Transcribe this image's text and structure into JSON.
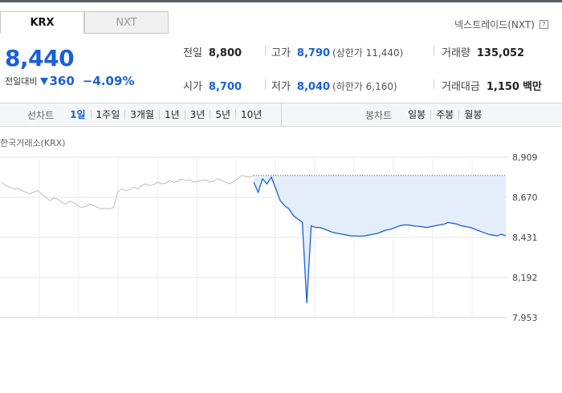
{
  "tabs": [
    {
      "label": "KRX",
      "active": true
    },
    {
      "label": "NXT",
      "active": false
    }
  ],
  "nxt_link": {
    "label": "넥스트레이드(NXT)",
    "icon": "help-icon"
  },
  "quote": {
    "price": "8,440",
    "change_label": "전일대비",
    "change_value": "360",
    "change_direction": "down",
    "change_pct": "−4.09%"
  },
  "stats": {
    "prev_close": {
      "label": "전일",
      "value": "8,800"
    },
    "high": {
      "label": "고가",
      "value": "8,790",
      "sub": "(상한가 11,440)"
    },
    "volume": {
      "label": "거래량",
      "value": "135,052"
    },
    "open": {
      "label": "시가",
      "value": "8,700"
    },
    "low": {
      "label": "저가",
      "value": "8,040",
      "sub": "(하한가 6,160)"
    },
    "amount": {
      "label": "거래대금",
      "value": "1,150",
      "unit": "백만"
    }
  },
  "toolbar": {
    "line_label": "선차트",
    "line_periods": [
      {
        "label": "1일",
        "active": true
      },
      {
        "label": "1주일",
        "active": false
      },
      {
        "label": "3개월",
        "active": false
      },
      {
        "label": "1년",
        "active": false
      },
      {
        "label": "3년",
        "active": false
      },
      {
        "label": "5년",
        "active": false
      },
      {
        "label": "10년",
        "active": false
      }
    ],
    "candle_label": "봉차트",
    "candle_periods": [
      {
        "label": "일봉"
      },
      {
        "label": "주봉"
      },
      {
        "label": "월봉"
      }
    ]
  },
  "chart_source": "한국거래소(KRX)",
  "colors": {
    "accent": "#1a5fd6",
    "prev_line": "#bdbdbd",
    "fill": "#e4eefb"
  },
  "chart_data": {
    "type": "line",
    "ylim": [
      7953,
      8909
    ],
    "yticks": [
      "8,909",
      "8,670",
      "8,431",
      "8,192",
      "7,953"
    ],
    "reference_line": 8800,
    "series": [
      {
        "values": [
          8760,
          8740,
          8730,
          8720,
          8725,
          8710,
          8700,
          8690,
          8700,
          8710,
          8690,
          8670,
          8650,
          8665,
          8660,
          8640,
          8630,
          8645,
          8640,
          8620,
          8610,
          8615,
          8630,
          8620,
          8610,
          8600,
          8605,
          8600,
          8610,
          8700,
          8720,
          8710,
          8715,
          8730,
          8720,
          8740,
          8750,
          8740,
          8745,
          8760,
          8750,
          8755,
          8770,
          8760,
          8765,
          8780,
          8770,
          8775,
          8760,
          8765,
          8770,
          8775,
          8760,
          8765,
          8780,
          8770,
          8760,
          8750,
          8765,
          8780,
          8800,
          8795,
          8790,
          8800
        ]
      },
      {
        "values": [
          8760,
          8700,
          8780,
          8750,
          8790,
          8720,
          8650,
          8620,
          8600,
          8560,
          8540,
          8520,
          8040,
          8500,
          8490,
          8490,
          8480,
          8470,
          8460,
          8455,
          8450,
          8445,
          8440,
          8440,
          8438,
          8440,
          8445,
          8450,
          8455,
          8465,
          8475,
          8480,
          8490,
          8500,
          8505,
          8505,
          8500,
          8498,
          8495,
          8490,
          8495,
          8500,
          8505,
          8510,
          8520,
          8515,
          8510,
          8500,
          8495,
          8490,
          8480,
          8470,
          8460,
          8450,
          8445,
          8440,
          8450,
          8440
        ]
      }
    ]
  }
}
